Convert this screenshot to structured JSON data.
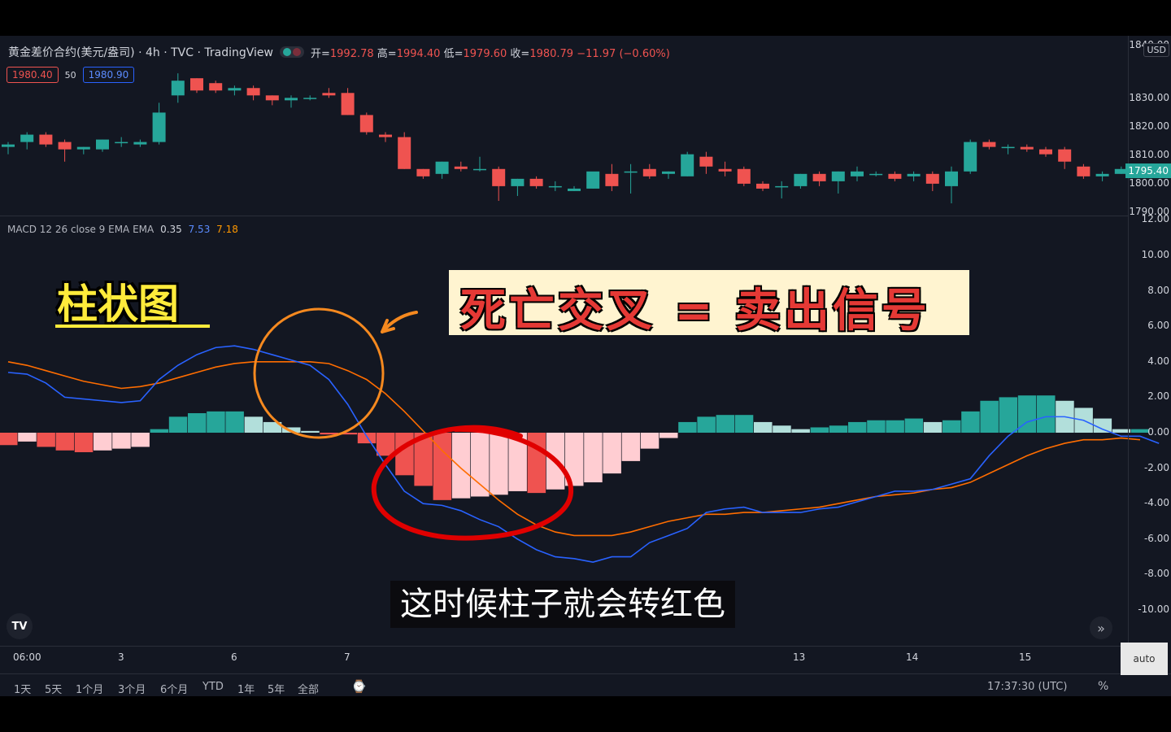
{
  "header": {
    "symbol": "黄金差价合约(美元/盎司) · 4h · TVC · TradingView",
    "ohlc": {
      "open_label": "开=",
      "open": "1992.78",
      "high_label": "高=",
      "high": "1994.40",
      "low_label": "低=",
      "low": "1979.60",
      "close_label": "收=",
      "close": "1980.79",
      "change": "−11.97 (−0.60%)"
    },
    "sell_pill": "1980.40",
    "spread": "50",
    "buy_pill": "1980.90"
  },
  "macd_legend": {
    "label": "MACD 12 26 close 9 EMA EMA",
    "hist": "0.35",
    "macd": "7.53",
    "signal": "7.18"
  },
  "price_axis": {
    "currency": "USD",
    "labels": [
      "1840.00",
      "1830.00",
      "1820.00",
      "1810.00",
      "1800.00",
      "1790.00"
    ],
    "current": "1795.40"
  },
  "macd_axis": {
    "labels": [
      "12.00",
      "10.00",
      "8.00",
      "6.00",
      "4.00",
      "2.00",
      "0.00",
      "-2.00",
      "-4.00",
      "-6.00",
      "-8.00",
      "-10.00"
    ]
  },
  "time_axis": {
    "labels": [
      "06:00",
      "3",
      "6",
      "7",
      "13",
      "14",
      "15"
    ]
  },
  "range_buttons": [
    "1天",
    "5天",
    "1个月",
    "3个月",
    "6个月",
    "YTD",
    "1年",
    "5年",
    "全部"
  ],
  "clock": "17:37:30 (UTC)",
  "percent_label": "%",
  "auto_label": "auto",
  "annotations": {
    "histogram": "柱状图",
    "death_cross": "死亡交叉 = 卖出信号"
  },
  "subtitle": "这时候柱子就会转红色",
  "colors": {
    "bg": "#131722",
    "up": "#26a69a",
    "down": "#ef5350",
    "macd_line": "#2962ff",
    "signal_line": "#ff6d00",
    "hist_down_light": "#ffcdd2",
    "hist_up_light": "#b2dfdb",
    "annotation_circle": "#f5891f",
    "annotation_ring": "#e00000"
  },
  "chart_data": [
    {
      "type": "candlestick",
      "ylim": [
        1783,
        1846
      ],
      "candles": [
        {
          "o": 1806,
          "h": 1808,
          "l": 1803,
          "c": 1807
        },
        {
          "o": 1808,
          "h": 1812,
          "l": 1805,
          "c": 1811
        },
        {
          "o": 1811,
          "h": 1812,
          "l": 1806,
          "c": 1807
        },
        {
          "o": 1808,
          "h": 1809,
          "l": 1800,
          "c": 1805
        },
        {
          "o": 1805,
          "h": 1806,
          "l": 1803,
          "c": 1806
        },
        {
          "o": 1805,
          "h": 1809,
          "l": 1804,
          "c": 1809
        },
        {
          "o": 1808,
          "h": 1810,
          "l": 1806,
          "c": 1808
        },
        {
          "o": 1807,
          "h": 1809,
          "l": 1806,
          "c": 1808
        },
        {
          "o": 1808,
          "h": 1824,
          "l": 1807,
          "c": 1820
        },
        {
          "o": 1827,
          "h": 1836,
          "l": 1824,
          "c": 1833
        },
        {
          "o": 1834,
          "h": 1834,
          "l": 1828,
          "c": 1829
        },
        {
          "o": 1832,
          "h": 1833,
          "l": 1828,
          "c": 1829
        },
        {
          "o": 1829,
          "h": 1831,
          "l": 1827,
          "c": 1830
        },
        {
          "o": 1830,
          "h": 1831,
          "l": 1825,
          "c": 1827
        },
        {
          "o": 1827,
          "h": 1827,
          "l": 1823,
          "c": 1825
        },
        {
          "o": 1825,
          "h": 1827,
          "l": 1822,
          "c": 1826
        },
        {
          "o": 1826,
          "h": 1827,
          "l": 1825,
          "c": 1826
        },
        {
          "o": 1828,
          "h": 1830,
          "l": 1826,
          "c": 1827
        },
        {
          "o": 1828,
          "h": 1830,
          "l": 1819,
          "c": 1819
        },
        {
          "o": 1819,
          "h": 1820,
          "l": 1811,
          "c": 1812
        },
        {
          "o": 1811,
          "h": 1812,
          "l": 1808,
          "c": 1810
        },
        {
          "o": 1810,
          "h": 1812,
          "l": 1797,
          "c": 1797
        },
        {
          "o": 1797,
          "h": 1797,
          "l": 1793,
          "c": 1794
        },
        {
          "o": 1795,
          "h": 1800,
          "l": 1793,
          "c": 1800
        },
        {
          "o": 1798,
          "h": 1800,
          "l": 1796,
          "c": 1797
        },
        {
          "o": 1797,
          "h": 1802,
          "l": 1796,
          "c": 1797
        },
        {
          "o": 1797,
          "h": 1798,
          "l": 1784,
          "c": 1790
        },
        {
          "o": 1790,
          "h": 1793,
          "l": 1786,
          "c": 1793
        },
        {
          "o": 1793,
          "h": 1794,
          "l": 1789,
          "c": 1790
        },
        {
          "o": 1790,
          "h": 1792,
          "l": 1788,
          "c": 1790
        },
        {
          "o": 1788,
          "h": 1790,
          "l": 1788,
          "c": 1789
        },
        {
          "o": 1789,
          "h": 1794,
          "l": 1789,
          "c": 1796
        },
        {
          "o": 1795,
          "h": 1799,
          "l": 1788,
          "c": 1790
        },
        {
          "o": 1796,
          "h": 1799,
          "l": 1787,
          "c": 1796
        },
        {
          "o": 1797,
          "h": 1799,
          "l": 1793,
          "c": 1794
        },
        {
          "o": 1795,
          "h": 1796,
          "l": 1793,
          "c": 1796
        },
        {
          "o": 1794,
          "h": 1804,
          "l": 1794,
          "c": 1803
        },
        {
          "o": 1802,
          "h": 1804,
          "l": 1795,
          "c": 1798
        },
        {
          "o": 1797,
          "h": 1800,
          "l": 1794,
          "c": 1796
        },
        {
          "o": 1797,
          "h": 1798,
          "l": 1790,
          "c": 1791
        },
        {
          "o": 1791,
          "h": 1792,
          "l": 1788,
          "c": 1789
        },
        {
          "o": 1790,
          "h": 1792,
          "l": 1785,
          "c": 1790
        },
        {
          "o": 1790,
          "h": 1795,
          "l": 1789,
          "c": 1795
        },
        {
          "o": 1795,
          "h": 1796,
          "l": 1790,
          "c": 1792
        },
        {
          "o": 1792,
          "h": 1796,
          "l": 1787,
          "c": 1796
        },
        {
          "o": 1794,
          "h": 1798,
          "l": 1792,
          "c": 1796
        },
        {
          "o": 1795,
          "h": 1796,
          "l": 1794,
          "c": 1795
        },
        {
          "o": 1795,
          "h": 1796,
          "l": 1792,
          "c": 1793
        },
        {
          "o": 1794,
          "h": 1796,
          "l": 1792,
          "c": 1795
        },
        {
          "o": 1795,
          "h": 1796,
          "l": 1788,
          "c": 1791
        },
        {
          "o": 1790,
          "h": 1798,
          "l": 1783,
          "c": 1796
        },
        {
          "o": 1796,
          "h": 1809,
          "l": 1795,
          "c": 1808
        },
        {
          "o": 1808,
          "h": 1809,
          "l": 1805,
          "c": 1806
        },
        {
          "o": 1806,
          "h": 1807,
          "l": 1803,
          "c": 1806
        },
        {
          "o": 1806,
          "h": 1807,
          "l": 1804,
          "c": 1805
        },
        {
          "o": 1805,
          "h": 1806,
          "l": 1802,
          "c": 1803
        },
        {
          "o": 1805,
          "h": 1806,
          "l": 1797,
          "c": 1800
        },
        {
          "o": 1798,
          "h": 1799,
          "l": 1793,
          "c": 1794
        },
        {
          "o": 1794,
          "h": 1796,
          "l": 1792,
          "c": 1795
        },
        {
          "o": 1795,
          "h": 1798,
          "l": 1795,
          "c": 1797
        },
        {
          "o": 1796,
          "h": 1798,
          "l": 1795,
          "c": 1797
        }
      ]
    },
    {
      "type": "bar",
      "title": "MACD",
      "ylim": [
        -11,
        13
      ],
      "histogram": [
        -0.7,
        -0.5,
        -0.8,
        -1.0,
        -1.1,
        -1.0,
        -0.9,
        -0.8,
        0.2,
        0.9,
        1.1,
        1.2,
        1.2,
        0.9,
        0.6,
        0.3,
        0.1,
        -0.1,
        -0.1,
        -0.6,
        -1.3,
        -2.4,
        -3.0,
        -3.8,
        -3.7,
        -3.6,
        -3.5,
        -3.3,
        -3.4,
        -3.2,
        -3.0,
        -2.8,
        -2.3,
        -1.6,
        -0.9,
        -0.3,
        0.6,
        0.9,
        1.0,
        1.0,
        0.6,
        0.4,
        0.2,
        0.3,
        0.4,
        0.6,
        0.7,
        0.7,
        0.8,
        0.6,
        0.7,
        1.2,
        1.8,
        2.0,
        2.1,
        2.1,
        1.8,
        1.4,
        0.8,
        0.2,
        0.2
      ],
      "macd_line": [
        3.4,
        3.3,
        2.8,
        2.0,
        1.9,
        1.8,
        1.7,
        1.8,
        3.0,
        3.8,
        4.4,
        4.8,
        4.9,
        4.7,
        4.4,
        4.1,
        3.8,
        3.0,
        1.6,
        -0.2,
        -1.8,
        -3.3,
        -4.0,
        -4.1,
        -4.4,
        -4.9,
        -5.3,
        -6.0,
        -6.6,
        -7.0,
        -7.1,
        -7.3,
        -7.0,
        -7.0,
        -6.2,
        -5.8,
        -5.4,
        -4.5,
        -4.3,
        -4.2,
        -4.5,
        -4.5,
        -4.5,
        -4.3,
        -4.2,
        -3.9,
        -3.6,
        -3.3,
        -3.3,
        -3.2,
        -2.9,
        -2.6,
        -1.3,
        -0.2,
        0.6,
        0.9,
        0.9,
        0.7,
        0.2,
        -0.2,
        -0.2,
        -0.6
      ],
      "signal_line": [
        4.0,
        3.8,
        3.5,
        3.2,
        2.9,
        2.7,
        2.5,
        2.6,
        2.8,
        3.1,
        3.4,
        3.7,
        3.9,
        4.0,
        4.0,
        4.0,
        4.0,
        3.9,
        3.5,
        3.0,
        2.2,
        1.2,
        0.1,
        -1.0,
        -2.0,
        -2.9,
        -3.8,
        -4.6,
        -5.2,
        -5.6,
        -5.8,
        -5.8,
        -5.8,
        -5.6,
        -5.3,
        -5.0,
        -4.8,
        -4.6,
        -4.6,
        -4.5,
        -4.5,
        -4.4,
        -4.3,
        -4.2,
        -4.0,
        -3.8,
        -3.6,
        -3.5,
        -3.4,
        -3.2,
        -3.1,
        -2.8,
        -2.3,
        -1.8,
        -1.3,
        -0.9,
        -0.6,
        -0.4,
        -0.4,
        -0.3,
        -0.4
      ]
    }
  ]
}
